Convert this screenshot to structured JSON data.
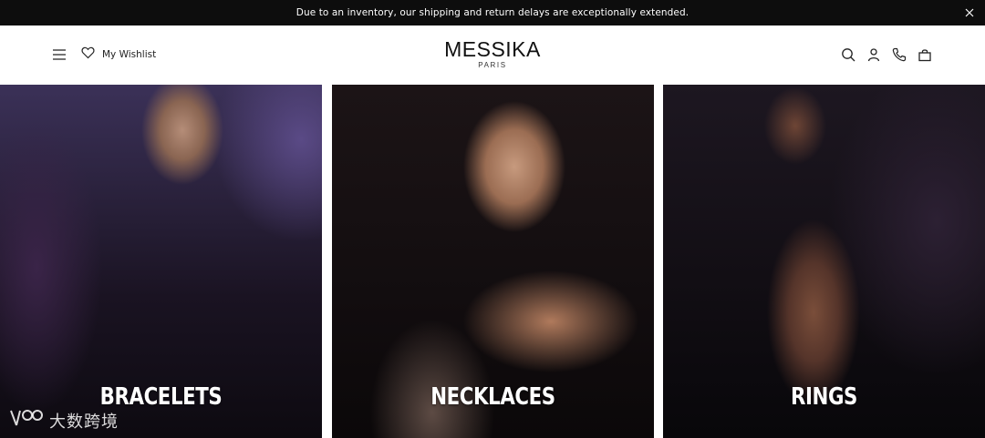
{
  "announcement": {
    "text": "Due to an inventory, our shipping and return delays are exceptionally extended.",
    "close_icon": "close-icon"
  },
  "header": {
    "menu_icon": "hamburger-icon",
    "wishlist": {
      "icon": "heart-icon",
      "label": "My Wishlist"
    },
    "logo": {
      "main": "MESSIKA",
      "sub": "PARIS"
    },
    "right_icons": [
      "search-icon",
      "account-icon",
      "phone-icon",
      "bag-icon"
    ]
  },
  "categories": [
    {
      "label": "BRACELETS"
    },
    {
      "label": "NECKLACES"
    },
    {
      "label": "RINGS"
    }
  ],
  "watermark": {
    "text": "大数跨境"
  },
  "colors": {
    "announce_bg": "#0d0d0d",
    "header_bg": "#ffffff",
    "text_dark": "#111111",
    "label_white": "#ffffff"
  }
}
